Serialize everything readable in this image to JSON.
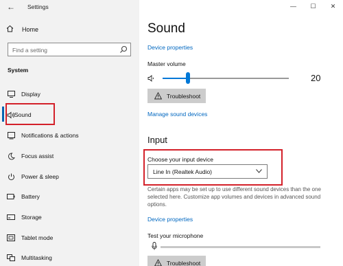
{
  "window": {
    "title": "Settings",
    "controls": {
      "minimize": "—",
      "maximize": "☐",
      "close": "✕"
    }
  },
  "sidebar": {
    "back_icon": "back-arrow-icon",
    "home_label": "Home",
    "search": {
      "placeholder": "Find a setting",
      "icon": "search-icon"
    },
    "section_label": "System",
    "items": [
      {
        "label": "Display",
        "icon": "display-icon"
      },
      {
        "label": "Sound",
        "icon": "speaker-icon",
        "selected": true
      },
      {
        "label": "Notifications & actions",
        "icon": "notifications-icon"
      },
      {
        "label": "Focus assist",
        "icon": "moon-icon"
      },
      {
        "label": "Power & sleep",
        "icon": "power-icon"
      },
      {
        "label": "Battery",
        "icon": "battery-icon"
      },
      {
        "label": "Storage",
        "icon": "storage-icon"
      },
      {
        "label": "Tablet mode",
        "icon": "tablet-icon"
      },
      {
        "label": "Multitasking",
        "icon": "multitasking-icon"
      }
    ]
  },
  "main": {
    "title": "Sound",
    "output": {
      "device_properties_link": "Device properties",
      "master_volume_label": "Master volume",
      "volume_value": "20",
      "volume_level": 0.2,
      "troubleshoot_label": "Troubleshoot",
      "manage_devices_link": "Manage sound devices"
    },
    "input": {
      "section_title": "Input",
      "choose_label": "Choose your input device",
      "selected_device": "Line In (Realtek Audio)",
      "description": "Certain apps may be set up to use different sound devices than the one selected here. Customize app volumes and devices in advanced sound options.",
      "device_properties_link": "Device properties",
      "test_mic_label": "Test your microphone",
      "troubleshoot_label": "Troubleshoot"
    }
  },
  "colors": {
    "accent": "#0078d7",
    "link": "#0067c0",
    "highlight": "#d32029",
    "sidebar_bg": "#f2f2f2"
  }
}
